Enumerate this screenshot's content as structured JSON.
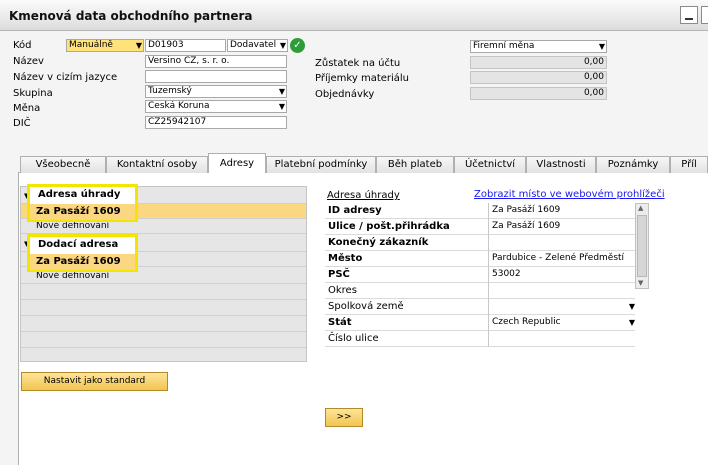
{
  "window": {
    "title": "Kmenová data obchodního partnera"
  },
  "header": {
    "kod_label": "Kód",
    "kod_series": "Manuálně",
    "kod_value": "D01903",
    "kod_type": "Dodavatel",
    "nazev_label": "Název",
    "nazev_value": "Versino CZ, s. r. o.",
    "nazev_cizi_label": "Název v cizím jazyce",
    "nazev_cizi_value": "",
    "skupina_label": "Skupina",
    "skupina_value": "Tuzemský",
    "mena_label": "Měna",
    "mena_value": "Česká Koruna",
    "dic_label": "DIČ",
    "dic_value": "CZ25942107"
  },
  "balances": {
    "currency_value": "Firemní měna",
    "zustatek_label": "Zůstatek na účtu",
    "zustatek_value": "0,00",
    "prijemky_label": "Příjemky materiálu",
    "prijemky_value": "0,00",
    "objednavky_label": "Objednávky",
    "objednavky_value": "0,00"
  },
  "tabs": [
    {
      "label": "Všeobecně"
    },
    {
      "label": "Kontaktní osoby"
    },
    {
      "label": "Adresy"
    },
    {
      "label": "Platební podmínky"
    },
    {
      "label": "Běh plateb"
    },
    {
      "label": "Účetnictví"
    },
    {
      "label": "Vlastnosti"
    },
    {
      "label": "Poznámky"
    },
    {
      "label": "Příl"
    }
  ],
  "addresses": {
    "billing_header": "Adresa úhrady",
    "billing_item": "Za Pasáží 1609",
    "billing_new": "Nové definování",
    "shipping_header": "Dodací adresa",
    "shipping_item": "Za Pasáží 1609",
    "shipping_new": "Nové definování",
    "set_default_label": "Nastavit jako standard"
  },
  "detail": {
    "title": "Adresa úhrady",
    "map_link": "Zobrazit místo ve webovém prohlížeči",
    "rows": [
      {
        "label": "ID adresy",
        "value": "Za Pasáží 1609"
      },
      {
        "label": "Ulice / pošt.přihrádka",
        "value": "Za Pasáží 1609"
      },
      {
        "label": "Konečný zákazník",
        "value": ""
      },
      {
        "label": "Město",
        "value": "Pardubice - Zelené Předměstí"
      },
      {
        "label": "PSČ",
        "value": "53002"
      },
      {
        "label": "Okres",
        "value": ""
      },
      {
        "label": "Spolková země",
        "value": ""
      },
      {
        "label": "Stát",
        "value": "Czech Republic"
      },
      {
        "label": "Číslo ulice",
        "value": ""
      }
    ],
    "next_label": ">>"
  },
  "icons": {
    "confirm": "check-circle-icon",
    "dropdown": "chevron-down-icon",
    "expand": "triangle-down-icon"
  },
  "colors": {
    "accent": "#fcd782",
    "highlight_border": "#f2e600",
    "ok_green": "#2e9d39",
    "link": "#1a1aee"
  }
}
